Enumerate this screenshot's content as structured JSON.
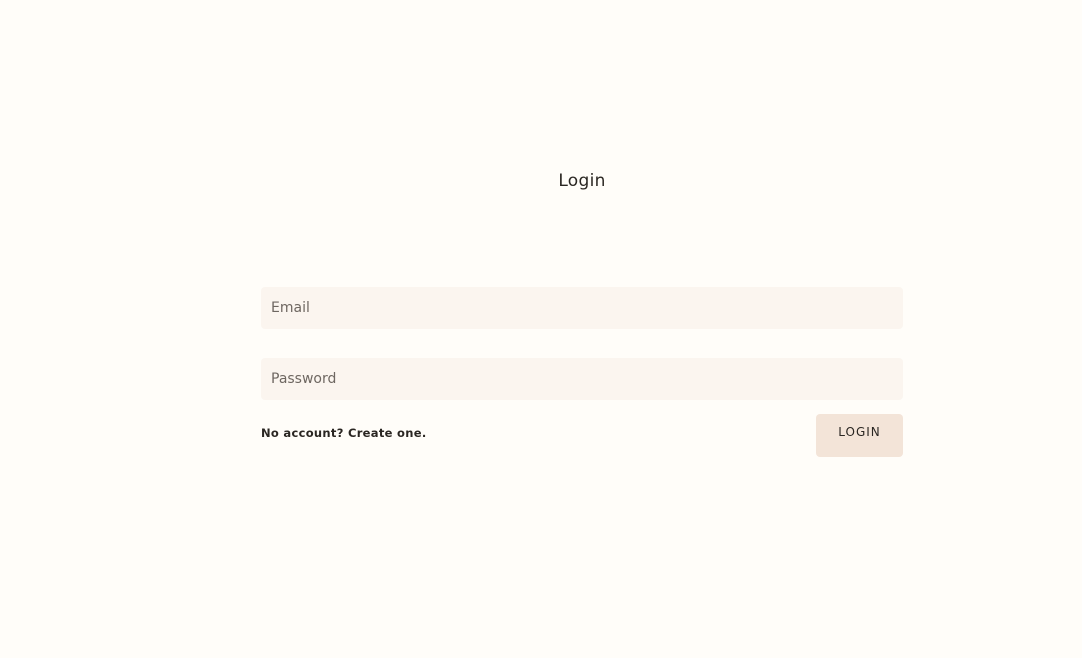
{
  "page": {
    "title": "Login"
  },
  "form": {
    "email_placeholder": "Email",
    "email_value": "",
    "password_placeholder": "Password",
    "password_value": "",
    "signup_link": "No account? Create one.",
    "submit_label": "LOGIN"
  },
  "colors": {
    "background": "#fffdf9",
    "field_background": "#fbf5ef",
    "button_background": "#f3e4d8",
    "text": "#2a2622"
  }
}
